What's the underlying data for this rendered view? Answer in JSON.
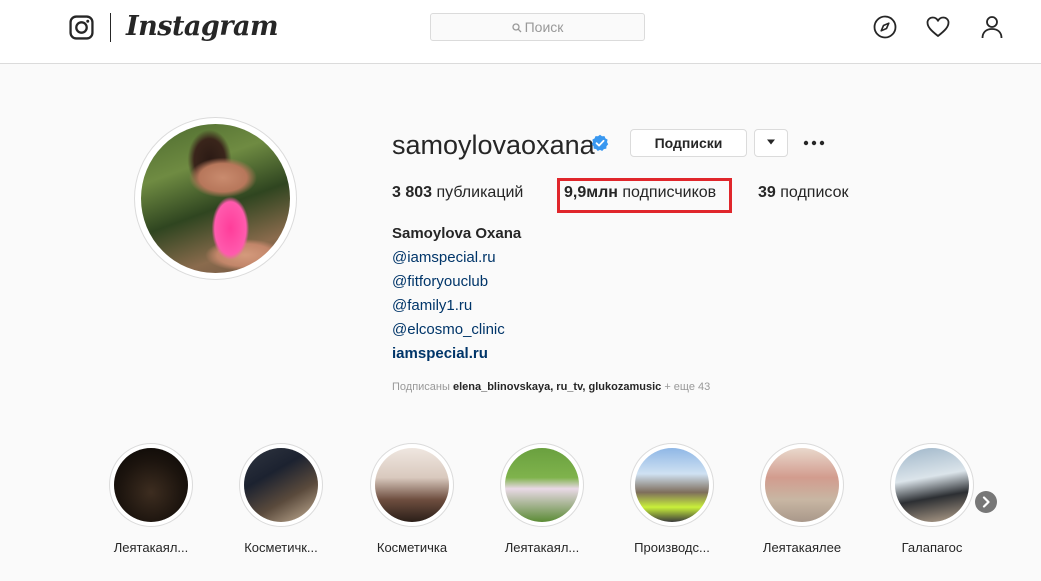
{
  "header": {
    "wordmark": "Instagram",
    "search": {
      "placeholder": "Поиск"
    },
    "nav_icons": [
      "explore-compass-icon",
      "activity-heart-icon",
      "profile-person-icon"
    ]
  },
  "profile": {
    "username": "samoylovaoxana",
    "verified": true,
    "following_button_label": "Подписки",
    "stats": {
      "posts_count": "3 803",
      "posts_label": "публикаций",
      "followers_count": "9,9млн",
      "followers_label": "подписчиков",
      "following_count": "39",
      "following_label": "подписок"
    },
    "full_name": "Samoylova Oxana",
    "bio_lines": [
      "@iamspecial.ru",
      "@fitforyouclub",
      "@family1.ru",
      "@elcosmo_clinic"
    ],
    "website": "iamspecial.ru",
    "followed_by": {
      "prefix": "Подписаны",
      "names": "elena_blinovskaya, ru_tv, glukozamusic",
      "more": "+ еще 43"
    }
  },
  "highlights": [
    {
      "label": "Леятакаял..."
    },
    {
      "label": "Косметичк..."
    },
    {
      "label": "Косметичка"
    },
    {
      "label": "Леятакаял..."
    },
    {
      "label": "Производс..."
    },
    {
      "label": "Леятакаялее"
    },
    {
      "label": "Галапагос"
    }
  ],
  "colors": {
    "link": "#003569",
    "highlight_border": "#e0262b",
    "verified_badge": "#3897f0"
  }
}
